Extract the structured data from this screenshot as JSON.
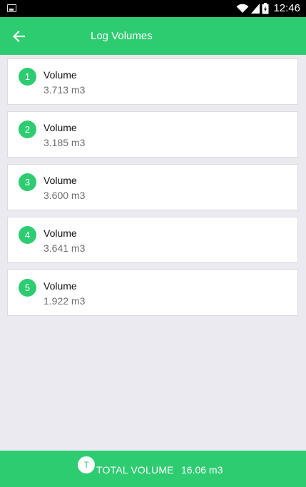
{
  "status_bar": {
    "time": "12:46",
    "icons": [
      "image-notification-icon",
      "wifi-icon",
      "signal-icon",
      "battery-icon"
    ]
  },
  "app_bar": {
    "title": "Log Volumes",
    "back_icon": "arrow-back-icon"
  },
  "logs": [
    {
      "index": "1",
      "label": "Volume",
      "value": "3.713 m3"
    },
    {
      "index": "2",
      "label": "Volume",
      "value": "3.185 m3"
    },
    {
      "index": "3",
      "label": "Volume",
      "value": "3.600 m3"
    },
    {
      "index": "4",
      "label": "Volume",
      "value": "3.641 m3"
    },
    {
      "index": "5",
      "label": "Volume",
      "value": "1.922 m3"
    }
  ],
  "footer": {
    "badge": "T",
    "label": "TOTAL VOLUME",
    "value": "16.06 m3"
  },
  "colors": {
    "accent": "#2ecc71",
    "background": "#eaeaf0",
    "status_bar": "#000000"
  }
}
